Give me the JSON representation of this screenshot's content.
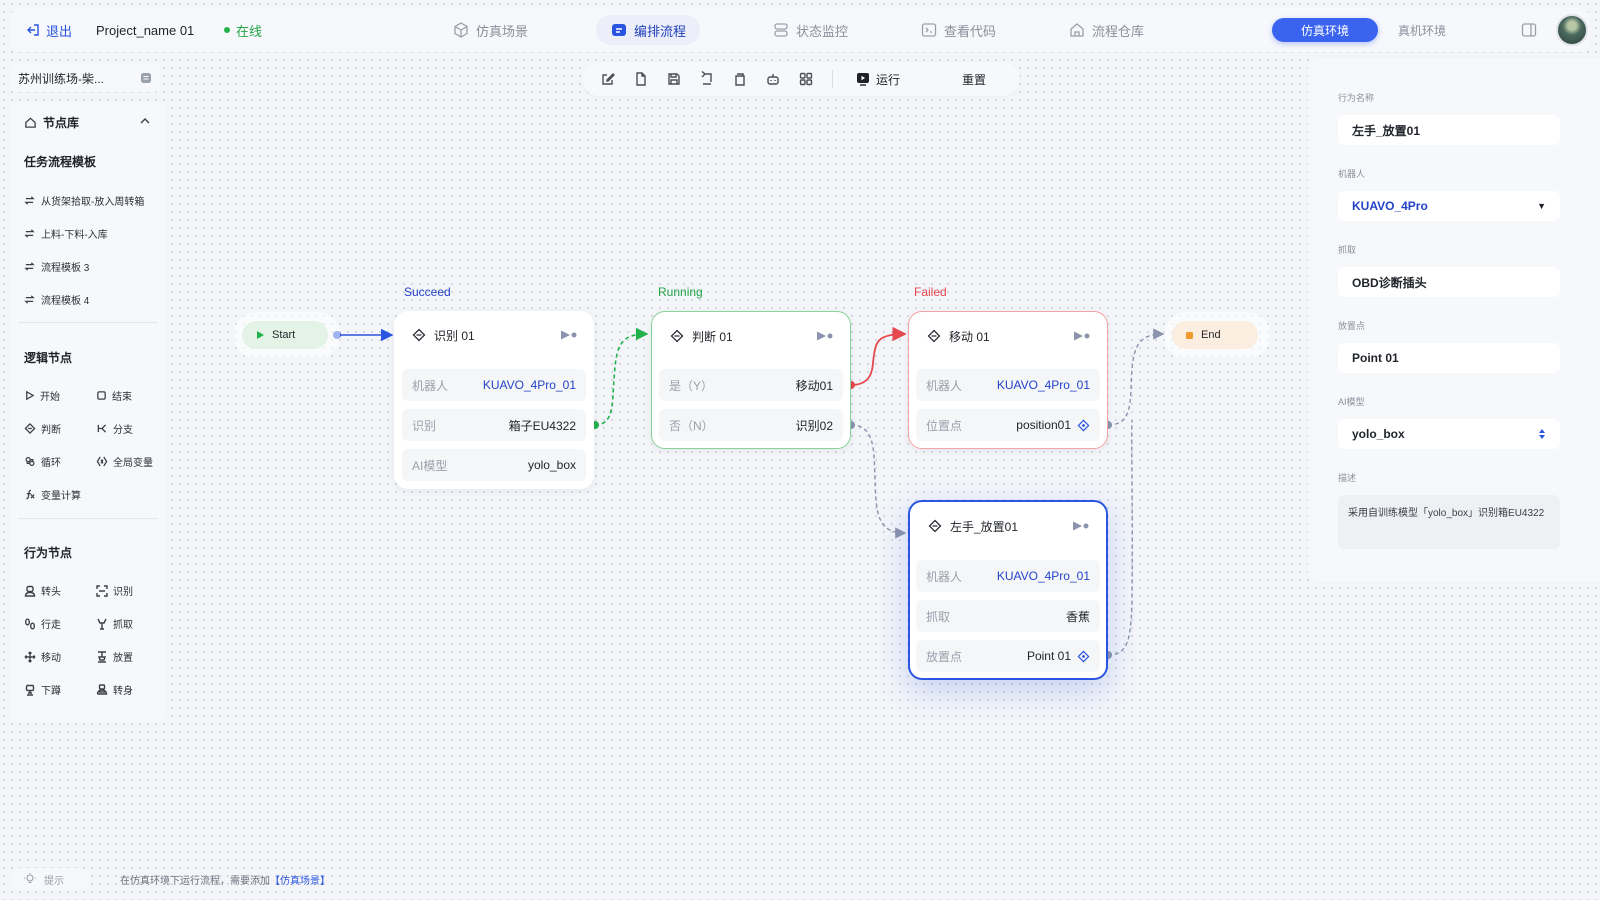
{
  "topbar": {
    "exit_label": "退出",
    "project_name": "Project_name 01",
    "status": "在线",
    "nav": [
      {
        "label": "仿真场景",
        "icon": "cube-icon"
      },
      {
        "label": "编排流程",
        "icon": "flow-icon",
        "active": true
      },
      {
        "label": "状态监控",
        "icon": "monitor-icon"
      },
      {
        "label": "查看代码",
        "icon": "code-icon"
      },
      {
        "label": "流程仓库",
        "icon": "warehouse-icon"
      }
    ],
    "env_sim": "仿真环境",
    "env_real": "真机环境"
  },
  "scene_select": {
    "value": "苏州训练场-柴..."
  },
  "library": {
    "title": "节点库",
    "templates_title": "任务流程模板",
    "templates": [
      "从货架拾取-放入周转箱",
      "上料-下料-入库",
      "流程模板 3",
      "流程模板 4"
    ],
    "logic_title": "逻辑节点",
    "logic": [
      "开始",
      "结束",
      "判断",
      "分支",
      "循环",
      "全局变量",
      "变量计算"
    ],
    "action_title": "行为节点",
    "action": [
      "转头",
      "识别",
      "行走",
      "抓取",
      "移动",
      "放置",
      "下蹲",
      "转身"
    ]
  },
  "toolbar": {
    "run": "运行",
    "reset": "重置"
  },
  "canvas": {
    "start_label": "Start",
    "end_label": "End",
    "nodes": {
      "recognize": {
        "status": "Succeed",
        "title": "识别 01",
        "rows": [
          {
            "k": "机器人",
            "v": "KUAVO_4Pro_01"
          },
          {
            "k": "识别",
            "v": "箱子EU4322"
          },
          {
            "k": "AI模型",
            "v": "yolo_box"
          }
        ]
      },
      "judge": {
        "status": "Running",
        "title": "判断 01",
        "rows": [
          {
            "k": "是（Y）",
            "v": "移动01"
          },
          {
            "k": "否（N）",
            "v": "识别02"
          }
        ]
      },
      "move": {
        "status": "Failed",
        "title": "移动 01",
        "rows": [
          {
            "k": "机器人",
            "v": "KUAVO_4Pro_01"
          },
          {
            "k": "位置点",
            "v": "position01"
          }
        ]
      },
      "place": {
        "title": "左手_放置01",
        "rows": [
          {
            "k": "机器人",
            "v": "KUAVO_4Pro_01"
          },
          {
            "k": "抓取",
            "v": "香蕉"
          },
          {
            "k": "放置点",
            "v": "Point 01"
          }
        ]
      }
    }
  },
  "properties": {
    "name_label": "行为名称",
    "name_value": "左手_放置01",
    "robot_label": "机器人",
    "robot_value": "KUAVO_4Pro",
    "grab_label": "抓取",
    "grab_value": "OBD诊断插头",
    "place_label": "放置点",
    "place_value": "Point 01",
    "model_label": "AI模型",
    "model_value": "yolo_box",
    "desc_label": "描述",
    "desc_value": "采用自训练模型「yolo_box」识别箱EU4322"
  },
  "footer": {
    "hint_label": "提示",
    "hint_text": "在仿真环境下运行流程，需要添加",
    "hint_link": "【仿真场景】"
  },
  "colors": {
    "accent": "#3a63f0",
    "success": "#22b24c",
    "failed": "#e5484d",
    "running": "#22b24c"
  }
}
